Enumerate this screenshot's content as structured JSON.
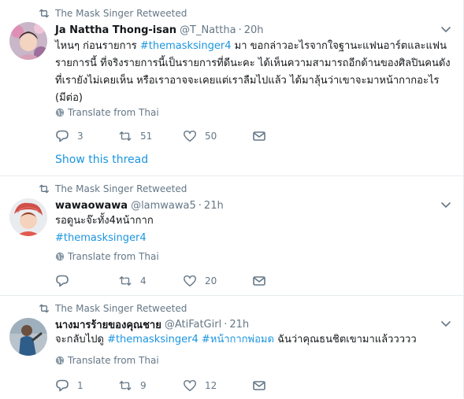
{
  "tweets": [
    {
      "retweeted_by": "The Mask Singer Retweeted",
      "display_name": "Ja Nattha Thong-isan",
      "handle": "@T_Nattha",
      "dot": "·",
      "time": "20h",
      "text_parts": [
        "ไหนๆ ก่อนรายการ ",
        "#themasksinger4",
        " มา ขอกล่าวอะไรจากใจฐานะแฟนอาร์ตและแฟนรายการนี้ ที่จริงรายการนี้เป็นรายการที่ดีนะคะ ได้เห็นความสามารถอีกด้านของศิลปินคนดังที่เรายังไม่เคยเห็น หรือเราอาจจะเคยแต่เราลืมไปแล้ว ได้มาลุ้นว่าเขาจะมาหน้ากากอะไร (มีต่อ)"
      ],
      "translate": "Translate from Thai",
      "replies": "3",
      "retweets": "51",
      "likes": "50",
      "show_thread": "Show this thread"
    },
    {
      "retweeted_by": "The Mask Singer Retweeted",
      "display_name": "wawaowawa",
      "handle": "@lamwawa5",
      "dot": "·",
      "time": "21h",
      "text_line1": "รอดูนะจ๊ะทั้ง4หน้ากาก",
      "hashtag": "#themasksinger4",
      "translate": "Translate from Thai",
      "replies": "",
      "retweets": "4",
      "likes": "20"
    },
    {
      "retweeted_by": "The Mask Singer Retweeted",
      "display_name": "นางมารร้ายของคุณชาย",
      "handle": "@AtiFatGirl",
      "dot": "·",
      "time": "21h",
      "text_parts": [
        "จะกลับไปดู ",
        "#themasksinger4",
        " ",
        "#หน้ากากพ่อมด",
        " ฉันว่าคุณธนชิตเขามาแล้ววววว"
      ],
      "translate": "Translate from Thai",
      "replies": "1",
      "retweets": "9",
      "likes": "12"
    }
  ],
  "icons": {
    "retweet": "retweet-icon",
    "reply": "reply-icon",
    "like": "heart-icon",
    "message": "envelope-icon",
    "translate": "globe-icon",
    "menu": "chevron-down-icon"
  },
  "colors": {
    "link": "#1b95e0",
    "muted": "#657786",
    "text": "#14171a",
    "divider": "#e6ecf0"
  }
}
